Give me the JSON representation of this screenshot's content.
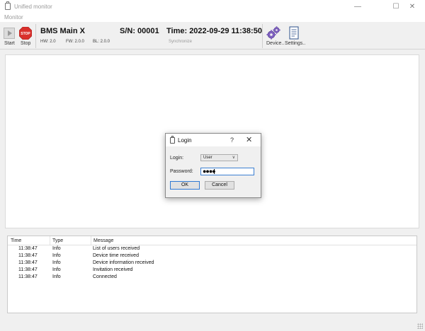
{
  "window": {
    "title": "Unified monitor"
  },
  "menu": {
    "monitor": "Monitor"
  },
  "toolbar": {
    "start_label": "Start",
    "stop_label": "Stop",
    "stop_sign_text": "STOP",
    "device_name": "BMS Main X",
    "serial": "S/N: 00001",
    "time": "Time: 2022-09-29 11:38:50",
    "hw": "HW: 2.0",
    "fw": "FW: 2.0.0",
    "bl": "BL: 2.0.0",
    "synchronize": "Synchronize",
    "device_label": "Device..",
    "settings_label": "Settings.."
  },
  "log": {
    "columns": {
      "time": "Time",
      "type": "Type",
      "message": "Message"
    },
    "rows": [
      {
        "time": "11:38:47",
        "type": "Info",
        "message": "List of users received"
      },
      {
        "time": "11:38:47",
        "type": "Info",
        "message": "Device time received"
      },
      {
        "time": "11:38:47",
        "type": "Info",
        "message": "Device information received"
      },
      {
        "time": "11:38:47",
        "type": "Info",
        "message": "Invitation received"
      },
      {
        "time": "11:38:47",
        "type": "Info",
        "message": "Connected"
      }
    ]
  },
  "dialog": {
    "title": "Login",
    "help": "?",
    "close": "✕",
    "login_label": "Login:",
    "login_value": "User",
    "password_label": "Password:",
    "password_value": "●●●●",
    "ok": "OK",
    "cancel": "Cancel"
  },
  "colors": {
    "accent": "#2f79d3",
    "stop_red": "#d9302c"
  },
  "icons": {
    "device": "gears-icon",
    "settings": "document-icon"
  }
}
